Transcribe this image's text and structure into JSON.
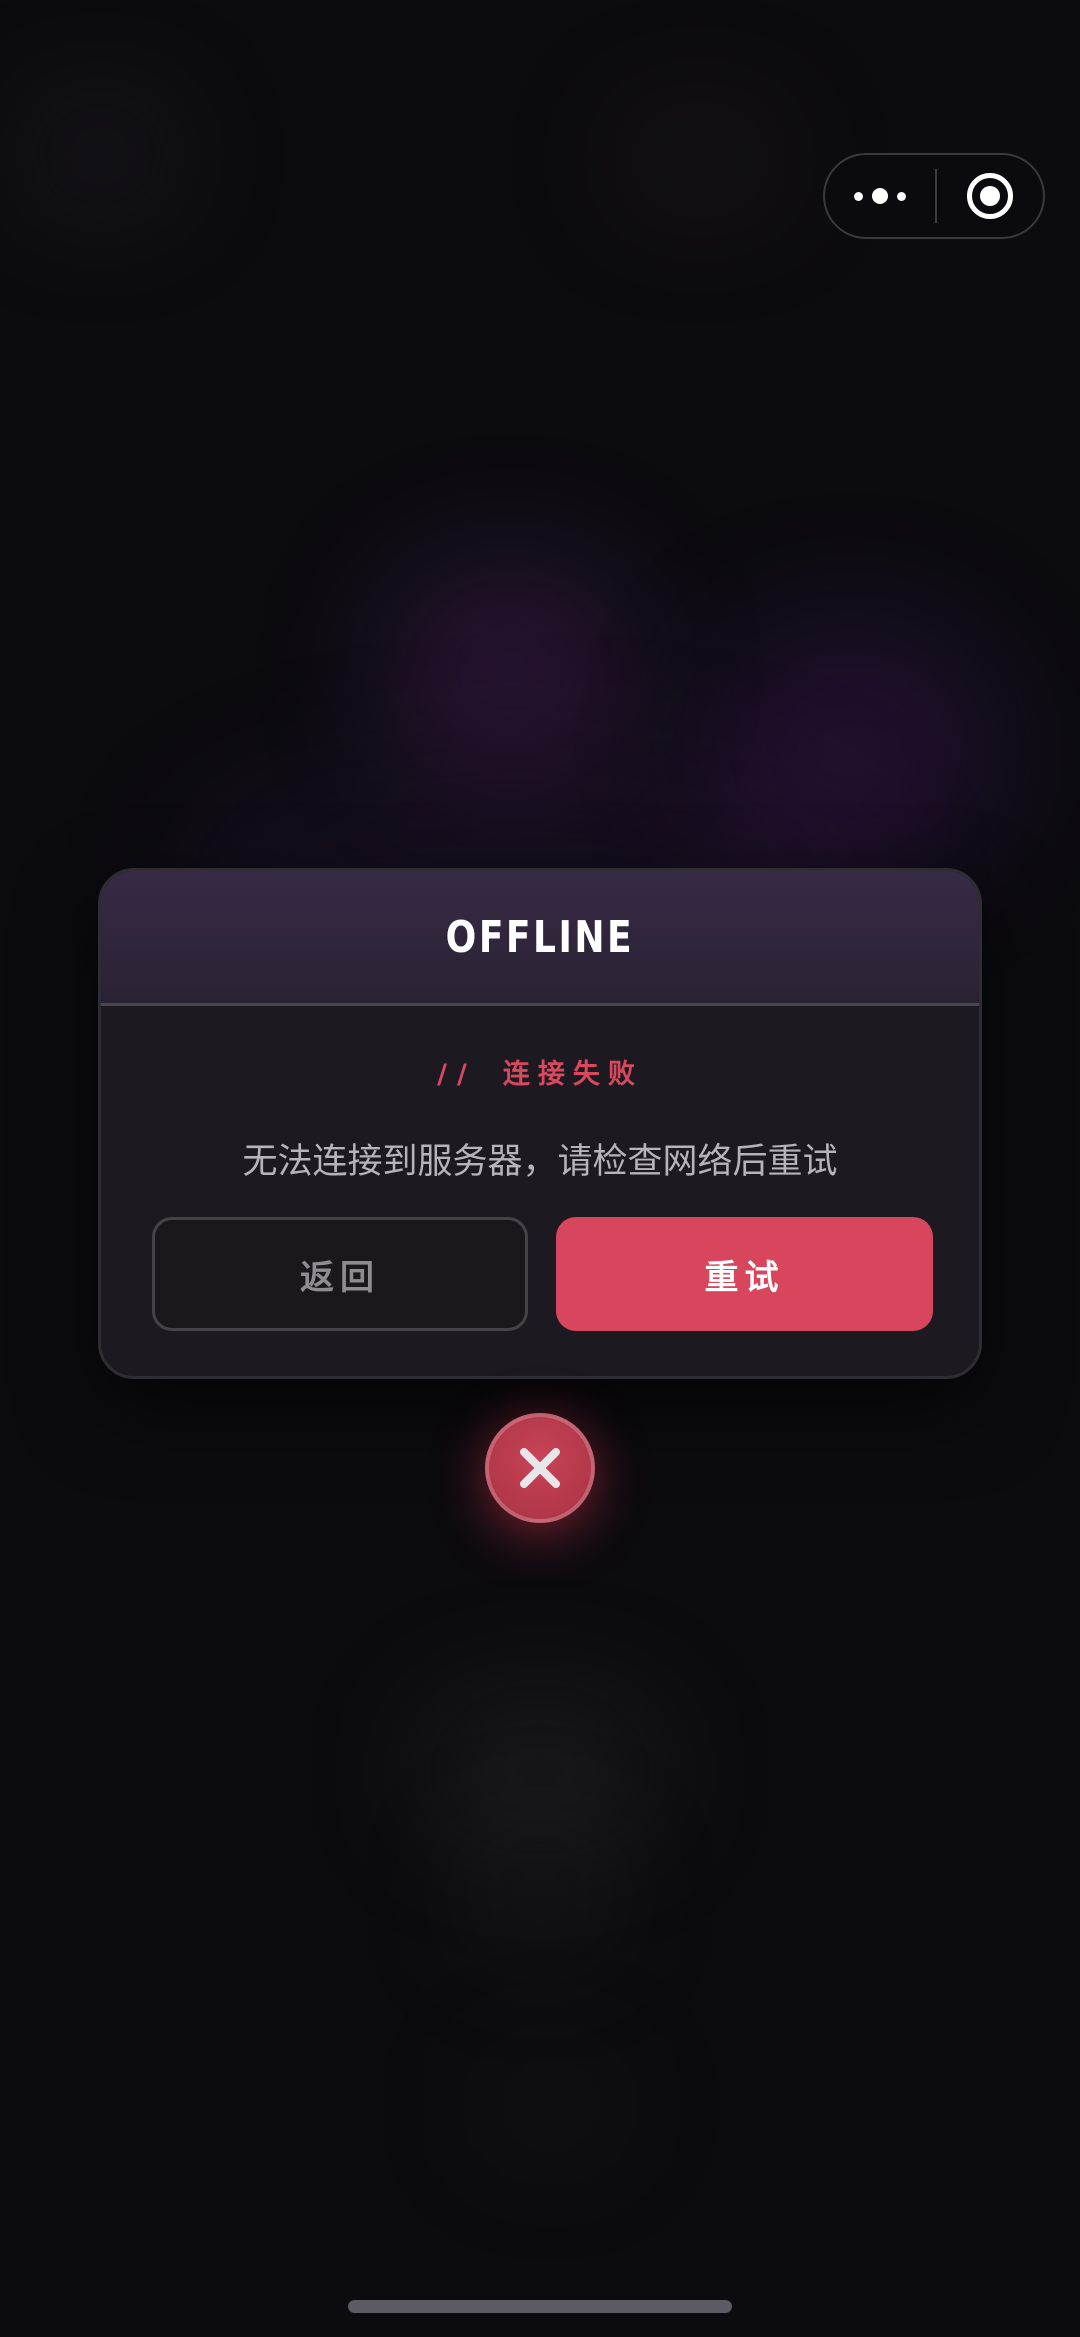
{
  "capsule": {
    "more_icon": "more-dots-icon",
    "close_icon": "target-circle-icon"
  },
  "dialog": {
    "title": "OFFLINE",
    "tag_slashes": "//",
    "tag_text": "连接失败",
    "message": "无法连接到服务器，请检查网络后重试",
    "back_label": "返回",
    "retry_label": "重试"
  },
  "close_button": {
    "icon": "close-icon"
  },
  "colors": {
    "accent": "#d8465d",
    "background": "#0c0b10",
    "dialog_bg": "#1c1a20",
    "header_bg": "#372a45"
  }
}
